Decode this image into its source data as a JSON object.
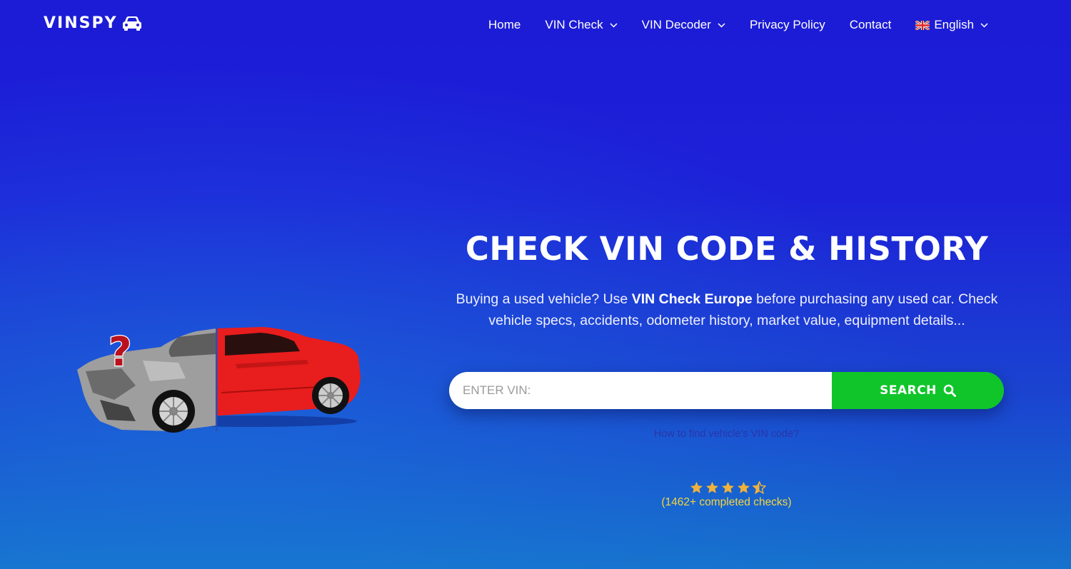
{
  "brand": {
    "logo_text": "VINSPY",
    "logo_icon": "car-icon"
  },
  "nav": {
    "items": [
      {
        "label": "Home",
        "dropdown": false
      },
      {
        "label": "VIN Check",
        "dropdown": true
      },
      {
        "label": "VIN Decoder",
        "dropdown": true
      },
      {
        "label": "Privacy Policy",
        "dropdown": false
      },
      {
        "label": "Contact",
        "dropdown": false
      },
      {
        "label": "English",
        "dropdown": true,
        "icon": "uk-flag-icon"
      }
    ]
  },
  "hero": {
    "title": "CHECK VIN CODE & HISTORY",
    "desc_prefix": "Buying a used vehicle? Use ",
    "desc_bold": "VIN Check Europe",
    "desc_suffix": " before purchasing any used car. Check vehicle specs, accidents, odometer history, market value, equipment details...",
    "illustration": "wrecked-vs-new-car-illustration"
  },
  "search": {
    "placeholder": "ENTER VIN:",
    "value": "",
    "button_label": "SEARCH",
    "button_icon": "search-icon"
  },
  "help_link": "How to find vehicle's VIN code?",
  "rating": {
    "stars": 4.5,
    "max_stars": 5,
    "text": "(1462+ completed checks)",
    "star_color": "#f0b23c"
  },
  "colors": {
    "background_top": "#1c1bd6",
    "background_bottom": "#1672cc",
    "search_button": "#10c52a",
    "rating_text": "#f5d53f"
  }
}
